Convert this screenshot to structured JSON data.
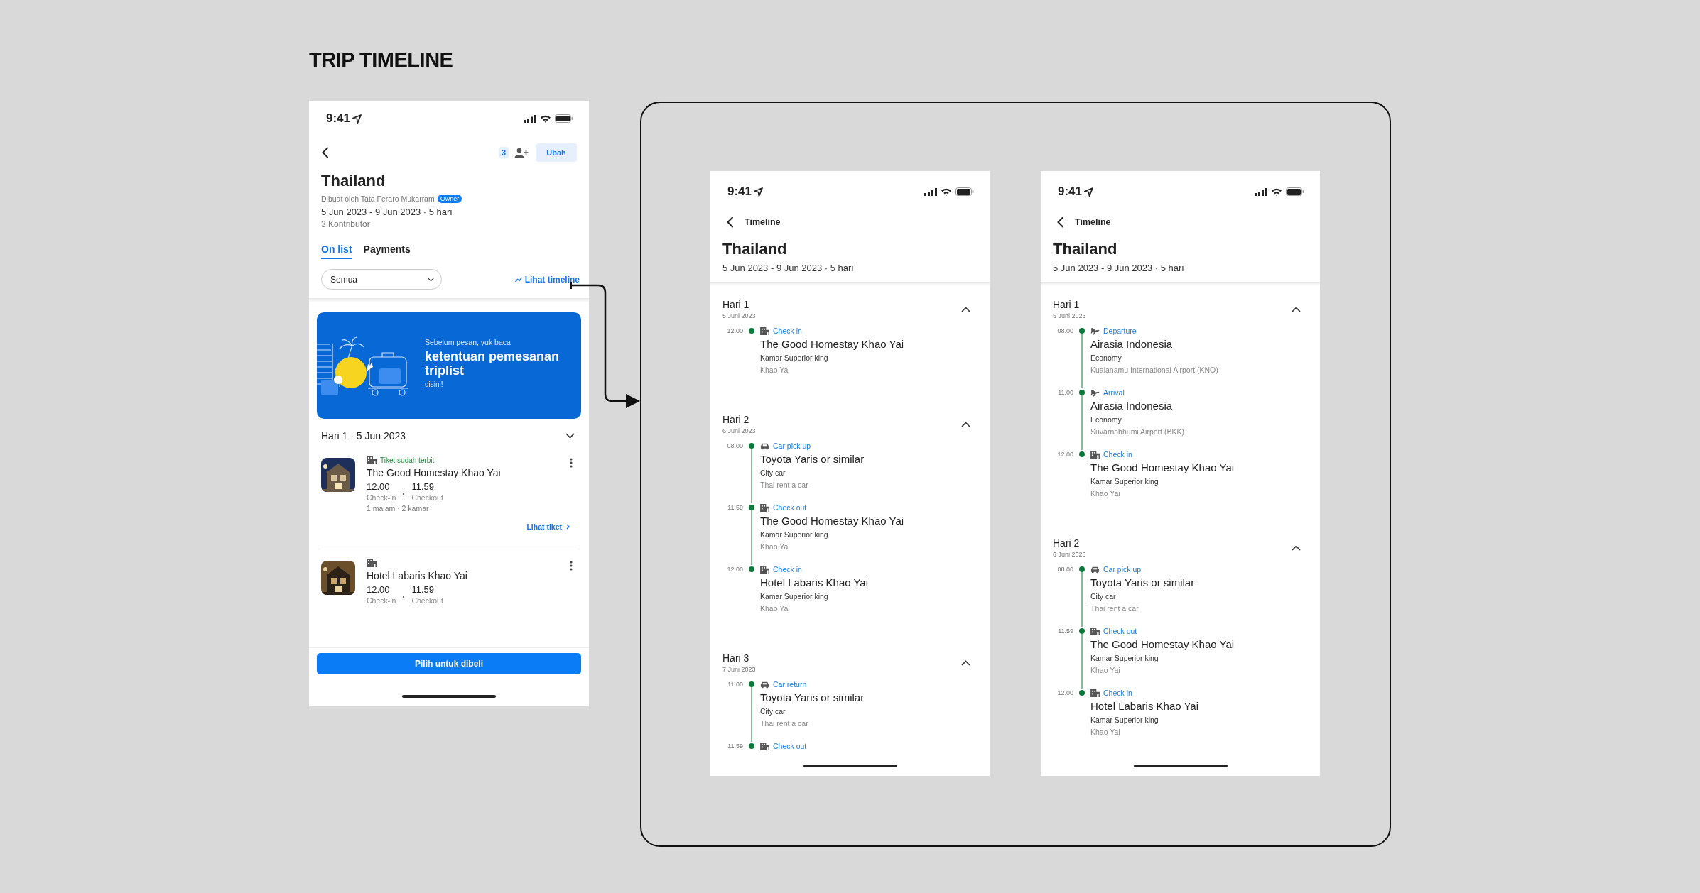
{
  "page_title": "TRIP TIMELINE",
  "trip_screen": {
    "status_time": "9:41",
    "contributor_count": "3",
    "edit_button": "Ubah",
    "title": "Thailand",
    "created_by": "Dibuat oleh Tata Feraro Mukarram",
    "owner_badge": "Owner",
    "dates": "5 Jun 2023 - 9 Jun 2023 · 5 hari",
    "contributors": "3 Kontributor",
    "tabs": [
      {
        "label": "On list",
        "selected": true
      },
      {
        "label": "Payments",
        "selected": false
      }
    ],
    "filter": {
      "value": "Semua"
    },
    "timeline_link": "Lihat timeline",
    "banner": {
      "intro": "Sebelum pesan, yuk baca",
      "headline": "ketentuan pemesanan triplist",
      "link": "disini!"
    },
    "day": {
      "label": "Hari 1 · 5 Jun 2023"
    },
    "items": [
      {
        "kind": "hotel",
        "status": "Tiket sudah terbit",
        "title": "The Good Homestay Khao Yai",
        "checkin_time": "12.00",
        "checkin_label": "Check-in",
        "checkout_time": "11.59",
        "checkout_label": "Checkout",
        "meta": "1 malam · 2 kamar",
        "link": "Lihat tiket"
      },
      {
        "kind": "hotel",
        "title": "Hotel Labaris Khao Yai",
        "checkin_time": "12.00",
        "checkin_label": "Check-in",
        "checkout_time": "11.59",
        "checkout_label": "Checkout"
      }
    ],
    "buy_button": "Pilih untuk dibeli"
  },
  "timeline_screens": [
    {
      "status_time": "9:41",
      "back_label": "Timeline",
      "title": "Thailand",
      "dates": "5 Jun 2023 - 9 Jun 2023 · 5 hari",
      "days": [
        {
          "label": "Hari 1",
          "date": "5 Juni 2023",
          "events": [
            {
              "kind": "hotel",
              "time": "12.00",
              "label": "Check in",
              "title": "The Good Homestay Khao Yai",
              "detail": "Kamar Superior king",
              "location": "Khao Yai"
            }
          ]
        },
        {
          "label": "Hari 2",
          "date": "6 Juni 2023",
          "events": [
            {
              "kind": "car",
              "time": "08.00",
              "label": "Car pick up",
              "title": "Toyota Yaris or similar",
              "detail": "City car",
              "location": "Thai rent a car"
            },
            {
              "kind": "hotel",
              "time": "11.59",
              "label": "Check out",
              "title": "The Good Homestay Khao Yai",
              "detail": "Kamar Superior king",
              "location": "Khao Yai"
            },
            {
              "kind": "hotel",
              "time": "12.00",
              "label": "Check in",
              "title": "Hotel Labaris Khao Yai",
              "detail": "Kamar Superior king",
              "location": "Khao Yai"
            }
          ]
        },
        {
          "label": "Hari 3",
          "date": "7 Juni 2023",
          "events": [
            {
              "kind": "car",
              "time": "11.00",
              "label": "Car return",
              "title": "Toyota Yaris or similar",
              "detail": "City car",
              "location": "Thai rent a car"
            },
            {
              "kind": "hotel",
              "time": "11.59",
              "label": "Check out"
            }
          ]
        }
      ]
    },
    {
      "status_time": "9:41",
      "back_label": "Timeline",
      "title": "Thailand",
      "dates": "5 Jun 2023 - 9 Jun 2023 · 5 hari",
      "days": [
        {
          "label": "Hari 1",
          "date": "5 Juni 2023",
          "events": [
            {
              "kind": "flight",
              "time": "08.00",
              "label": "Departure",
              "title": "Airasia Indonesia",
              "detail": "Economy",
              "location": "Kualanamu International Airport (KNO)"
            },
            {
              "kind": "flight",
              "time": "11.00",
              "label": "Arrival",
              "title": "Airasia Indonesia",
              "detail": "Economy",
              "location": "Suvarnabhumi Airport (BKK)"
            },
            {
              "kind": "hotel",
              "time": "12.00",
              "label": "Check in",
              "title": "The Good Homestay Khao Yai",
              "detail": "Kamar Superior king",
              "location": "Khao Yai"
            }
          ]
        },
        {
          "label": "Hari 2",
          "date": "6 Juni 2023",
          "events": [
            {
              "kind": "car",
              "time": "08.00",
              "label": "Car pick up",
              "title": "Toyota Yaris or similar",
              "detail": "City car",
              "location": "Thai rent a car"
            },
            {
              "kind": "hotel",
              "time": "11.59",
              "label": "Check out",
              "title": "The Good Homestay Khao Yai",
              "detail": "Kamar Superior king",
              "location": "Khao Yai"
            },
            {
              "kind": "hotel",
              "time": "12.00",
              "label": "Check in",
              "title": "Hotel Labaris Khao Yai",
              "detail": "Kamar Superior king",
              "location": "Khao Yai"
            }
          ]
        }
      ]
    }
  ]
}
